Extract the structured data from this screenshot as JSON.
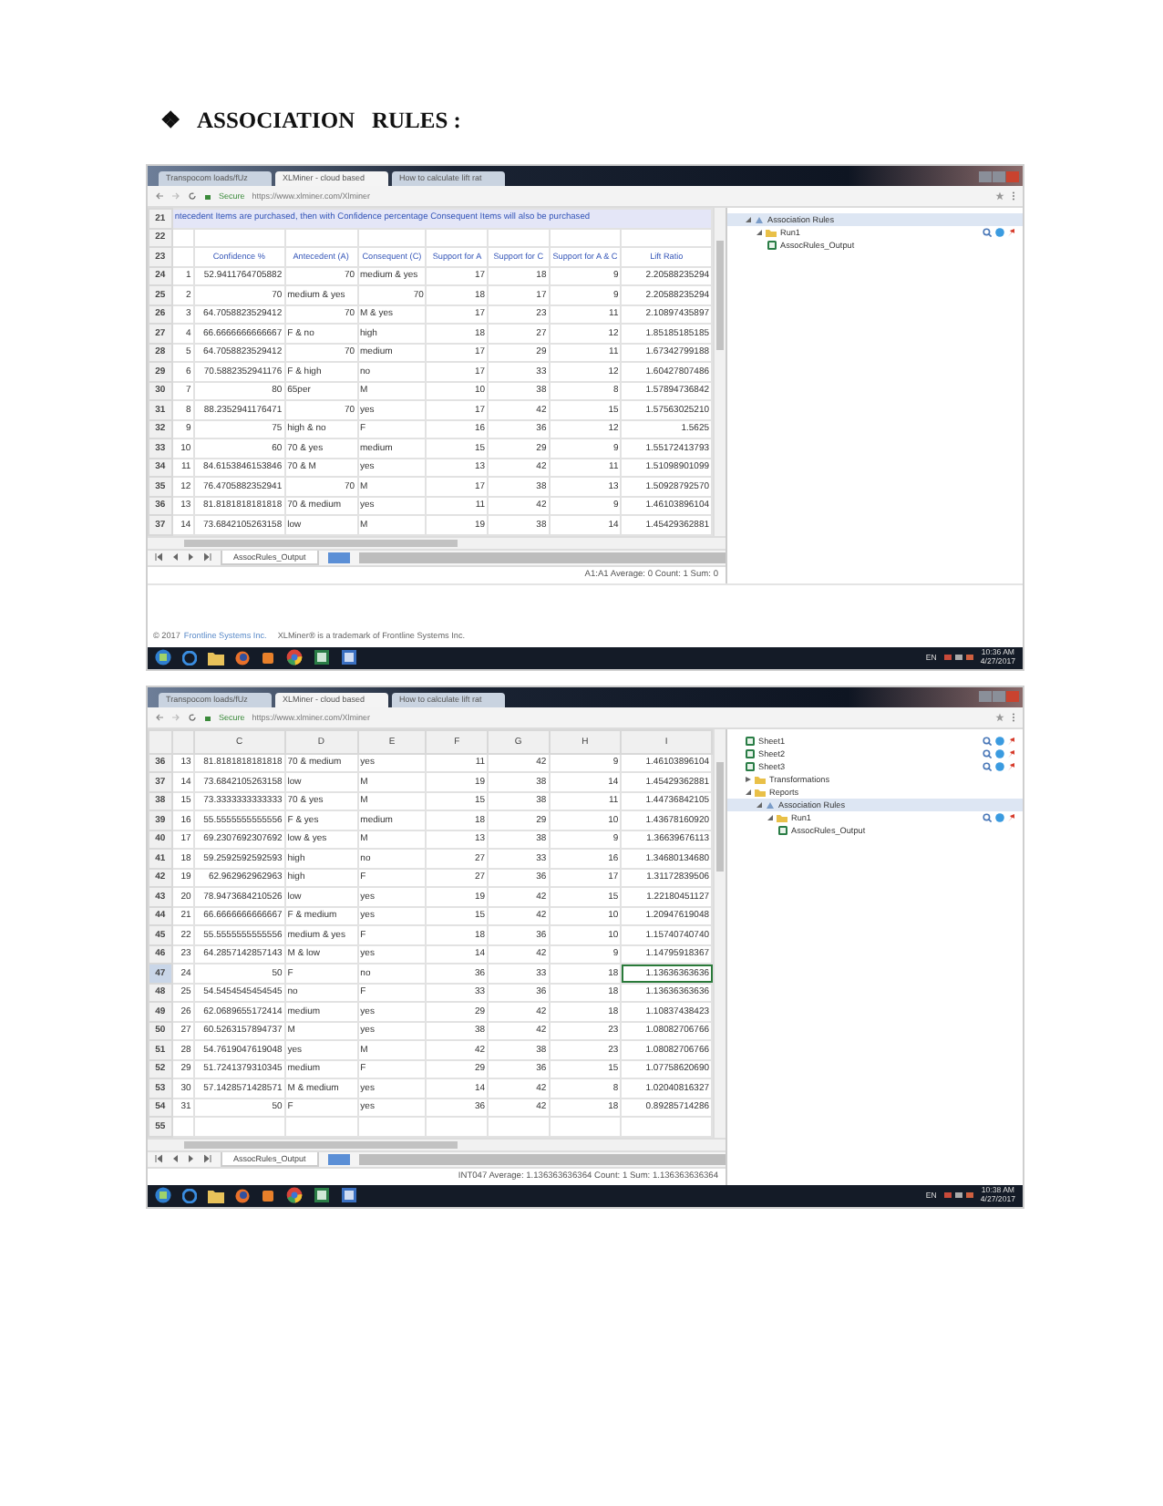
{
  "heading": {
    "bullet": "❖",
    "text": "ASSOCIATION   RULES :"
  },
  "screenshots": [
    {
      "browser_tabs": [
        {
          "label": "Transpocom loads/fUz",
          "selected": false
        },
        {
          "label": "XLMiner - cloud based",
          "selected": true
        },
        {
          "label": "How to calculate lift rat",
          "selected": false
        }
      ],
      "address": {
        "secure": "Secure",
        "url": "https://www.xlminer.com/Xlminer"
      },
      "rows": [
        {
          "number": "21",
          "kind": "message",
          "selected": false,
          "text": "ntecedent Items are purchased, then with Confidence percentage Consequent Items will also be purchased"
        },
        {
          "number": "22",
          "kind": "empty",
          "selected": false
        },
        {
          "number": "23",
          "kind": "header",
          "selected": false,
          "cells": [
            "Confidence %",
            "Antecedent (A)",
            "Consequent (C)",
            "Support for A",
            "Support for C",
            "Support for A & C",
            "Lift Ratio"
          ]
        },
        {
          "number": "24",
          "kind": "data",
          "selected": false,
          "cells": [
            "1",
            "52.9411764705882",
            "70",
            "medium & yes",
            "17",
            "18",
            "9",
            "2.20588235294"
          ]
        },
        {
          "number": "25",
          "kind": "data",
          "selected": false,
          "cells": [
            "2",
            "70",
            "medium & yes",
            "70",
            "18",
            "17",
            "9",
            "2.20588235294"
          ]
        },
        {
          "number": "26",
          "kind": "data",
          "selected": false,
          "cells": [
            "3",
            "64.7058823529412",
            "70",
            "M & yes",
            "17",
            "23",
            "11",
            "2.10897435897"
          ]
        },
        {
          "number": "27",
          "kind": "data",
          "selected": false,
          "cells": [
            "4",
            "66.6666666666667",
            "F & no",
            "high",
            "18",
            "27",
            "12",
            "1.85185185185"
          ]
        },
        {
          "number": "28",
          "kind": "data",
          "selected": false,
          "cells": [
            "5",
            "64.7058823529412",
            "70",
            "medium",
            "17",
            "29",
            "11",
            "1.67342799188"
          ]
        },
        {
          "number": "29",
          "kind": "data",
          "selected": false,
          "cells": [
            "6",
            "70.5882352941176",
            "F & high",
            "no",
            "17",
            "33",
            "12",
            "1.60427807486"
          ]
        },
        {
          "number": "30",
          "kind": "data",
          "selected": false,
          "cells": [
            "7",
            "80",
            "65per",
            "M",
            "10",
            "38",
            "8",
            "1.57894736842"
          ]
        },
        {
          "number": "31",
          "kind": "data",
          "selected": false,
          "cells": [
            "8",
            "88.2352941176471",
            "70",
            "yes",
            "17",
            "42",
            "15",
            "1.57563025210"
          ]
        },
        {
          "number": "32",
          "kind": "data",
          "selected": false,
          "cells": [
            "9",
            "75",
            "high & no",
            "F",
            "16",
            "36",
            "12",
            "1.5625"
          ]
        },
        {
          "number": "33",
          "kind": "data",
          "selected": false,
          "cells": [
            "10",
            "60",
            "70 & yes",
            "medium",
            "15",
            "29",
            "9",
            "1.55172413793"
          ]
        },
        {
          "number": "34",
          "kind": "data",
          "selected": false,
          "cells": [
            "11",
            "84.6153846153846",
            "70 & M",
            "yes",
            "13",
            "42",
            "11",
            "1.51098901099"
          ]
        },
        {
          "number": "35",
          "kind": "data",
          "selected": false,
          "cells": [
            "12",
            "76.4705882352941",
            "70",
            "M",
            "17",
            "38",
            "13",
            "1.50928792570"
          ]
        },
        {
          "number": "36",
          "kind": "data",
          "selected": false,
          "cells": [
            "13",
            "81.8181818181818",
            "70 & medium",
            "yes",
            "11",
            "42",
            "9",
            "1.46103896104"
          ]
        },
        {
          "number": "37",
          "kind": "data",
          "selected": false,
          "cells": [
            "14",
            "73.6842105263158",
            "low",
            "M",
            "19",
            "38",
            "14",
            "1.45429362881"
          ]
        }
      ],
      "sheet_tab": {
        "label": "AssocRules_Output",
        "selected": true
      },
      "status": "A1:A1 Average: 0 Count: 1 Sum: 0",
      "tree": [
        {
          "label": "Association Rules",
          "kind": "rules",
          "selected": true,
          "expanded": true,
          "children": [
            {
              "label": "Run1",
              "kind": "run",
              "selected": false,
              "expanded": true,
              "actions": true,
              "children": [
                {
                  "label": "AssocRules_Output",
                  "kind": "sheet",
                  "selected": false
                }
              ]
            }
          ]
        }
      ],
      "footer": {
        "copyright": "© 2017",
        "link": "Frontline Systems Inc.",
        "trademark": "XLMiner® is a trademark of Frontline Systems Inc."
      },
      "taskbar": {
        "language": "EN",
        "time": "10:36 AM",
        "date": "4/27/2017"
      }
    },
    {
      "browser_tabs": [
        {
          "label": "Transpocom loads/fUz",
          "selected": false
        },
        {
          "label": "XLMiner - cloud based",
          "selected": true
        },
        {
          "label": "How to calculate lift rat",
          "selected": false
        }
      ],
      "address": {
        "secure": "Secure",
        "url": "https://www.xlminer.com/Xlminer"
      },
      "columns": [
        "C",
        "D",
        "E",
        "F",
        "G",
        "H",
        "I"
      ],
      "rows": [
        {
          "number": "36",
          "kind": "data",
          "selected": false,
          "cells": [
            "13",
            "81.8181818181818",
            "70 & medium",
            "yes",
            "11",
            "42",
            "9",
            "1.46103896104"
          ]
        },
        {
          "number": "37",
          "kind": "data",
          "selected": false,
          "cells": [
            "14",
            "73.6842105263158",
            "low",
            "M",
            "19",
            "38",
            "14",
            "1.45429362881"
          ]
        },
        {
          "number": "38",
          "kind": "data",
          "selected": false,
          "cells": [
            "15",
            "73.3333333333333",
            "70 & yes",
            "M",
            "15",
            "38",
            "11",
            "1.44736842105"
          ]
        },
        {
          "number": "39",
          "kind": "data",
          "selected": false,
          "cells": [
            "16",
            "55.5555555555556",
            "F & yes",
            "medium",
            "18",
            "29",
            "10",
            "1.43678160920"
          ]
        },
        {
          "number": "40",
          "kind": "data",
          "selected": false,
          "cells": [
            "17",
            "69.2307692307692",
            "low & yes",
            "M",
            "13",
            "38",
            "9",
            "1.36639676113"
          ]
        },
        {
          "number": "41",
          "kind": "data",
          "selected": false,
          "cells": [
            "18",
            "59.2592592592593",
            "high",
            "no",
            "27",
            "33",
            "16",
            "1.34680134680"
          ]
        },
        {
          "number": "42",
          "kind": "data",
          "selected": false,
          "cells": [
            "19",
            "62.962962962963",
            "high",
            "F",
            "27",
            "36",
            "17",
            "1.31172839506"
          ]
        },
        {
          "number": "43",
          "kind": "data",
          "selected": false,
          "cells": [
            "20",
            "78.9473684210526",
            "low",
            "yes",
            "19",
            "42",
            "15",
            "1.22180451127"
          ]
        },
        {
          "number": "44",
          "kind": "data",
          "selected": false,
          "cells": [
            "21",
            "66.6666666666667",
            "F & medium",
            "yes",
            "15",
            "42",
            "10",
            "1.20947619048"
          ]
        },
        {
          "number": "45",
          "kind": "data",
          "selected": false,
          "cells": [
            "22",
            "55.5555555555556",
            "medium & yes",
            "F",
            "18",
            "36",
            "10",
            "1.15740740740"
          ]
        },
        {
          "number": "46",
          "kind": "data",
          "selected": false,
          "cells": [
            "23",
            "64.2857142857143",
            "M & low",
            "yes",
            "14",
            "42",
            "9",
            "1.14795918367"
          ]
        },
        {
          "number": "47",
          "kind": "data",
          "selected": true,
          "cells": [
            "24",
            "50",
            "F",
            "no",
            "36",
            "33",
            "18",
            "1.13636363636"
          ]
        },
        {
          "number": "48",
          "kind": "data",
          "selected": false,
          "cells": [
            "25",
            "54.5454545454545",
            "no",
            "F",
            "33",
            "36",
            "18",
            "1.13636363636"
          ]
        },
        {
          "number": "49",
          "kind": "data",
          "selected": false,
          "cells": [
            "26",
            "62.0689655172414",
            "medium",
            "yes",
            "29",
            "42",
            "18",
            "1.10837438423"
          ]
        },
        {
          "number": "50",
          "kind": "data",
          "selected": false,
          "cells": [
            "27",
            "60.5263157894737",
            "M",
            "yes",
            "38",
            "42",
            "23",
            "1.08082706766"
          ]
        },
        {
          "number": "51",
          "kind": "data",
          "selected": false,
          "cells": [
            "28",
            "54.7619047619048",
            "yes",
            "M",
            "42",
            "38",
            "23",
            "1.08082706766"
          ]
        },
        {
          "number": "52",
          "kind": "data",
          "selected": false,
          "cells": [
            "29",
            "51.7241379310345",
            "medium",
            "F",
            "29",
            "36",
            "15",
            "1.07758620690"
          ]
        },
        {
          "number": "53",
          "kind": "data",
          "selected": false,
          "cells": [
            "30",
            "57.1428571428571",
            "M & medium",
            "yes",
            "14",
            "42",
            "8",
            "1.02040816327"
          ]
        },
        {
          "number": "54",
          "kind": "data",
          "selected": false,
          "cells": [
            "31",
            "50",
            "F",
            "yes",
            "36",
            "42",
            "18",
            "0.89285714286"
          ]
        },
        {
          "number": "55",
          "kind": "empty",
          "selected": false
        }
      ],
      "sheet_tab": {
        "label": "AssocRules_Output",
        "selected": true
      },
      "status": "INT047 Average: 1.136363636364 Count: 1 Sum: 1.136363636364",
      "tree": [
        {
          "label": "Sheet1",
          "kind": "sheet",
          "selected": false,
          "actions": true
        },
        {
          "label": "Sheet2",
          "kind": "sheet",
          "selected": false,
          "actions": true
        },
        {
          "label": "Sheet3",
          "kind": "sheet",
          "selected": false,
          "actions": true
        },
        {
          "label": "Transformations",
          "kind": "folder",
          "selected": false,
          "expanded": false
        },
        {
          "label": "Reports",
          "kind": "folder",
          "selected": false,
          "expanded": true,
          "children": [
            {
              "label": "Association Rules",
              "kind": "rules",
              "selected": true,
              "expanded": true,
              "children": [
                {
                  "label": "Run1",
                  "kind": "run",
                  "selected": false,
                  "expanded": true,
                  "actions": true,
                  "children": [
                    {
                      "label": "AssocRules_Output",
                      "kind": "sheet",
                      "selected": false
                    }
                  ]
                }
              ]
            }
          ]
        }
      ],
      "taskbar": {
        "language": "EN",
        "time": "10:38 AM",
        "date": "4/27/2017"
      }
    }
  ]
}
